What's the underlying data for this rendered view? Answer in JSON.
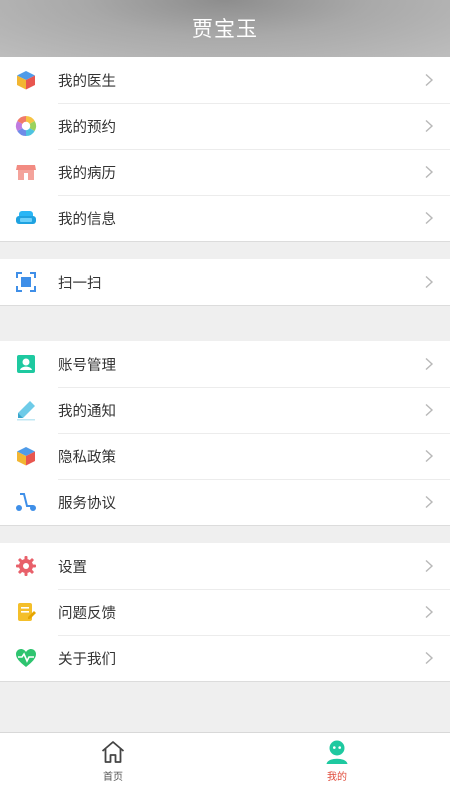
{
  "header": {
    "title": "贾宝玉"
  },
  "groups": [
    {
      "items": [
        {
          "label": "我的医生",
          "icon": "cube-icon"
        },
        {
          "label": "我的预约",
          "icon": "aperture-icon"
        },
        {
          "label": "我的病历",
          "icon": "shop-icon"
        },
        {
          "label": "我的信息",
          "icon": "sofa-icon"
        }
      ]
    },
    {
      "items": [
        {
          "label": "扫一扫",
          "icon": "scan-icon"
        }
      ]
    },
    {
      "items": [
        {
          "label": "账号管理",
          "icon": "account-icon"
        },
        {
          "label": "我的通知",
          "icon": "pencil-icon"
        },
        {
          "label": "隐私政策",
          "icon": "cube-icon"
        },
        {
          "label": "服务协议",
          "icon": "scooter-icon"
        }
      ]
    },
    {
      "items": [
        {
          "label": "设置",
          "icon": "gear-icon"
        },
        {
          "label": "问题反馈",
          "icon": "feedback-icon"
        },
        {
          "label": "关于我们",
          "icon": "heart-icon"
        }
      ]
    }
  ],
  "tabs": [
    {
      "label": "首页",
      "icon": "home-icon",
      "active": false
    },
    {
      "label": "我的",
      "icon": "profile-icon",
      "active": true
    }
  ],
  "colors": {
    "active_tab": "#e04b3a",
    "accent_green": "#1ec9a0"
  }
}
